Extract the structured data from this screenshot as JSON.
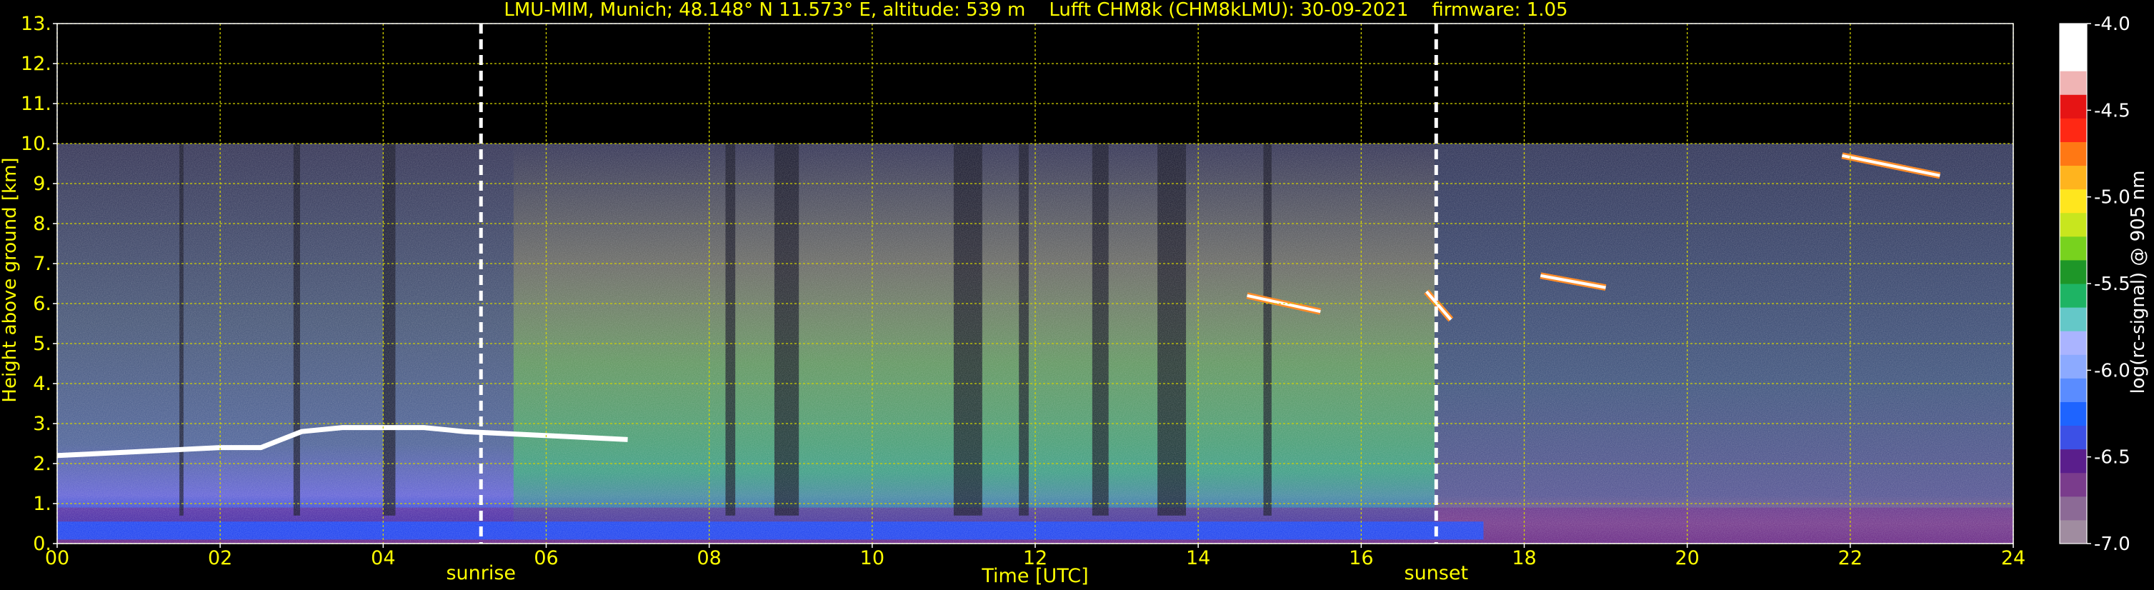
{
  "chart_data": {
    "type": "heatmap",
    "title": "LMU-MIM, Munich; 48.148° N 11.573° E, altitude: 539 m    Lufft CHM8k (CHM8kLMU): 30-09-2021    firmware: 1.05",
    "xlabel": "Time [UTC]",
    "ylabel": "Height above ground [km]",
    "colorbar_label": "log(rc-signal) @ 905 nm",
    "xlim": [
      0,
      24
    ],
    "ylim": [
      0,
      13
    ],
    "clim": [
      -7.0,
      -4.0
    ],
    "x_ticks": [
      0,
      2,
      4,
      6,
      8,
      10,
      12,
      14,
      16,
      18,
      20,
      22,
      24
    ],
    "x_tick_labels": [
      "00",
      "02",
      "04",
      "06",
      "08",
      "10",
      "12",
      "14",
      "16",
      "18",
      "20",
      "22",
      "24"
    ],
    "y_ticks": [
      0,
      1,
      2,
      3,
      4,
      5,
      6,
      7,
      8,
      9,
      10,
      11,
      12,
      13
    ],
    "y_tick_labels": [
      "0.",
      "1.",
      "2.",
      "3.",
      "4.",
      "5.",
      "6.",
      "7.",
      "8.",
      "9.",
      "10.",
      "11.",
      "12.",
      "13."
    ],
    "colorbar_ticks": [
      -4.0,
      -4.5,
      -5.0,
      -5.5,
      -6.0,
      -6.5,
      -7.0
    ],
    "colorbar_tick_labels": [
      "-4.0",
      "-4.5",
      "-5.0",
      "-5.5",
      "-6.0",
      "-6.5",
      "-7.0"
    ],
    "data_top_km": 10.0,
    "grid": true,
    "events": [
      {
        "label": "sunrise",
        "time": 5.2
      },
      {
        "label": "sunset",
        "time": 16.92
      }
    ],
    "features": {
      "boundary_layer_top_km": [
        {
          "time": 0.0,
          "height": 2.2
        },
        {
          "time": 1.0,
          "height": 2.3
        },
        {
          "time": 2.0,
          "height": 2.4
        },
        {
          "time": 2.5,
          "height": 2.4
        },
        {
          "time": 3.0,
          "height": 2.8
        },
        {
          "time": 3.5,
          "height": 2.9
        },
        {
          "time": 4.0,
          "height": 2.9
        },
        {
          "time": 4.5,
          "height": 2.9
        },
        {
          "time": 5.0,
          "height": 2.8
        },
        {
          "time": 6.0,
          "height": 2.7
        },
        {
          "time": 7.0,
          "height": 2.6
        }
      ],
      "cloud_segments_km": [
        {
          "t_start": 14.6,
          "t_end": 15.5,
          "h_start": 6.2,
          "h_end": 5.8
        },
        {
          "t_start": 16.8,
          "t_end": 17.1,
          "h_start": 6.3,
          "h_end": 5.6
        },
        {
          "t_start": 18.2,
          "t_end": 19.0,
          "h_start": 6.7,
          "h_end": 6.4
        },
        {
          "t_start": 21.9,
          "t_end": 23.1,
          "h_start": 9.7,
          "h_end": 9.2
        }
      ]
    },
    "colormap": [
      "#a08ca0",
      "#8c6a96",
      "#7a3c8c",
      "#5a1e8c",
      "#3c50e6",
      "#1e64ff",
      "#5a8cff",
      "#8caaff",
      "#aab4ff",
      "#64c8c8",
      "#1eb464",
      "#1e9628",
      "#78d21e",
      "#c8e61e",
      "#ffe61e",
      "#ffb41e",
      "#ff7814",
      "#ff2814",
      "#e61414",
      "#f0b4b4",
      "#ffffff",
      "#ffffff"
    ]
  }
}
